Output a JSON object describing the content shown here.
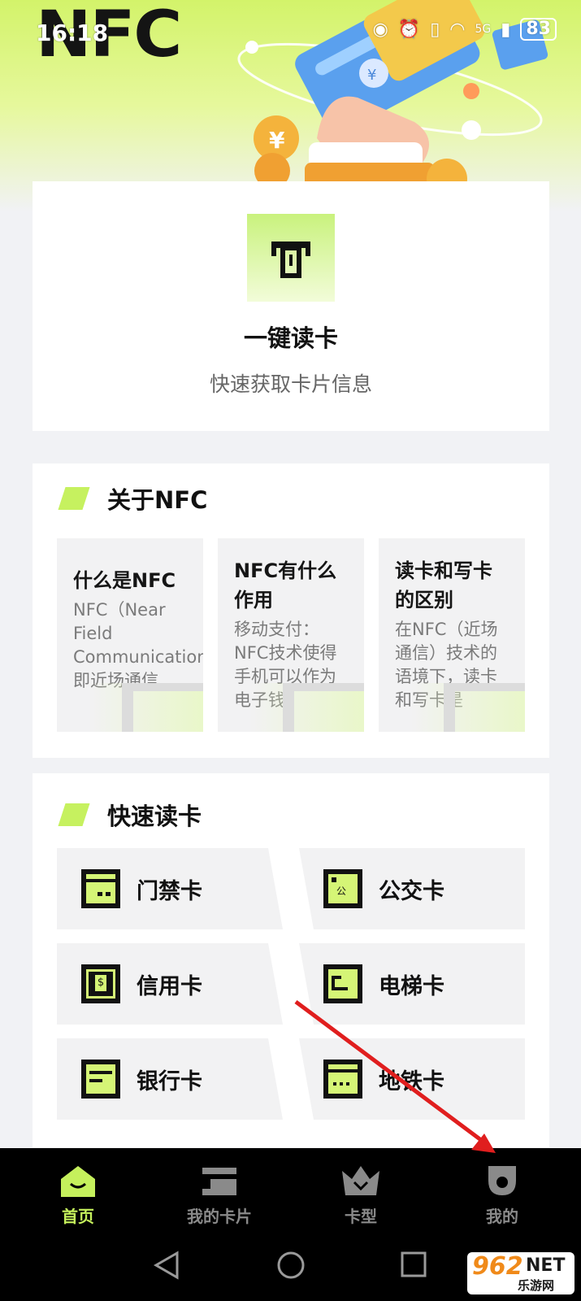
{
  "app": {
    "logo_text": "NFC"
  },
  "status_bar": {
    "time": "16:18",
    "network": "5G",
    "battery": "83"
  },
  "read_card": {
    "title": "一键读卡",
    "subtitle": "快速获取卡片信息"
  },
  "about": {
    "title": "关于NFC",
    "items": [
      {
        "title": "什么是NFC",
        "desc": "NFC（Near Field Communication），即近场通信…"
      },
      {
        "title": "NFC有什么作用",
        "desc": "移动支付：NFC技术使得手机可以作为电子钱"
      },
      {
        "title": "读卡和写卡的区别",
        "desc": "在NFC（近场通信）技术的语境下，读卡和写卡是"
      }
    ]
  },
  "quick_read": {
    "title": "快速读卡",
    "items": [
      {
        "label": "门禁卡",
        "icon": "access-card-icon"
      },
      {
        "label": "公交卡",
        "icon": "bus-card-icon",
        "glyph": "公"
      },
      {
        "label": "信用卡",
        "icon": "credit-card-icon",
        "glyph": "$"
      },
      {
        "label": "电梯卡",
        "icon": "elevator-card-icon"
      },
      {
        "label": "银行卡",
        "icon": "bank-card-icon"
      },
      {
        "label": "地铁卡",
        "icon": "metro-card-icon"
      }
    ]
  },
  "tabs": [
    {
      "label": "首页",
      "icon": "home-icon",
      "active": true
    },
    {
      "label": "我的卡片",
      "icon": "wallet-icon",
      "active": false
    },
    {
      "label": "卡型",
      "icon": "crown-icon",
      "active": false
    },
    {
      "label": "我的",
      "icon": "profile-icon",
      "active": false
    }
  ],
  "colors": {
    "accent": "#c5f05c",
    "tabbar_bg": "#000000",
    "annotation_arrow": "#e01e1e"
  },
  "watermark": {
    "num": "962",
    "net": "NET",
    "cn": "乐游网"
  }
}
